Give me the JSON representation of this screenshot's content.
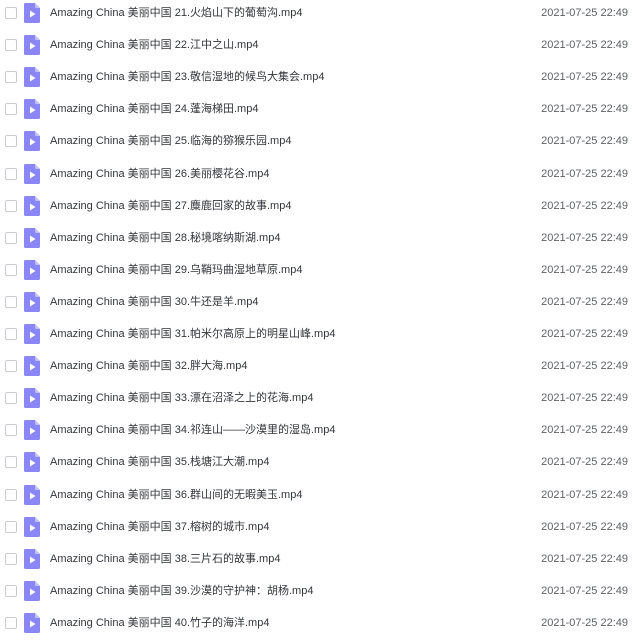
{
  "files": [
    {
      "name": "Amazing China 美丽中国 21.火焰山下的葡萄沟.mp4",
      "modified": "2021-07-25 22:49"
    },
    {
      "name": "Amazing China 美丽中国 22.江中之山.mp4",
      "modified": "2021-07-25 22:49"
    },
    {
      "name": "Amazing China 美丽中国 23.敬信湿地的候鸟大集会.mp4",
      "modified": "2021-07-25 22:49"
    },
    {
      "name": "Amazing China 美丽中国 24.蓬海梯田.mp4",
      "modified": "2021-07-25 22:49"
    },
    {
      "name": "Amazing China 美丽中国 25.临海的猕猴乐园.mp4",
      "modified": "2021-07-25 22:49"
    },
    {
      "name": "Amazing China 美丽中国 26.美丽樱花谷.mp4",
      "modified": "2021-07-25 22:49"
    },
    {
      "name": "Amazing China 美丽中国 27.麋鹿回家的故事.mp4",
      "modified": "2021-07-25 22:49"
    },
    {
      "name": "Amazing China 美丽中国 28.秘境喀纳斯湖.mp4",
      "modified": "2021-07-25 22:49"
    },
    {
      "name": "Amazing China 美丽中国 29.乌鞘玛曲湿地草原.mp4",
      "modified": "2021-07-25 22:49"
    },
    {
      "name": "Amazing China 美丽中国 30.牛还是羊.mp4",
      "modified": "2021-07-25 22:49"
    },
    {
      "name": "Amazing China 美丽中国 31.帕米尔高原上的明星山峰.mp4",
      "modified": "2021-07-25 22:49"
    },
    {
      "name": "Amazing China 美丽中国 32.胖大海.mp4",
      "modified": "2021-07-25 22:49"
    },
    {
      "name": "Amazing China 美丽中国 33.漂在沼泽之上的花海.mp4",
      "modified": "2021-07-25 22:49"
    },
    {
      "name": "Amazing China 美丽中国 34.祁连山——沙漠里的湿岛.mp4",
      "modified": "2021-07-25 22:49"
    },
    {
      "name": "Amazing China 美丽中国 35.栈塘江大潮.mp4",
      "modified": "2021-07-25 22:49"
    },
    {
      "name": "Amazing China 美丽中国 36.群山间的无暇美玉.mp4",
      "modified": "2021-07-25 22:49"
    },
    {
      "name": "Amazing China 美丽中国 37.榕树的城市.mp4",
      "modified": "2021-07-25 22:49"
    },
    {
      "name": "Amazing China 美丽中国 38.三片石的故事.mp4",
      "modified": "2021-07-25 22:49"
    },
    {
      "name": "Amazing China 美丽中国 39.沙漠的守护神：胡杨.mp4",
      "modified": "2021-07-25 22:49"
    },
    {
      "name": "Amazing China 美丽中国 40.竹子的海洋.mp4",
      "modified": "2021-07-25 22:49"
    }
  ],
  "icon": "video-file-icon",
  "colors": {
    "icon_body": "#8b86f5",
    "icon_fold": "#c5c2fb",
    "play_glyph": "#ffffff"
  }
}
